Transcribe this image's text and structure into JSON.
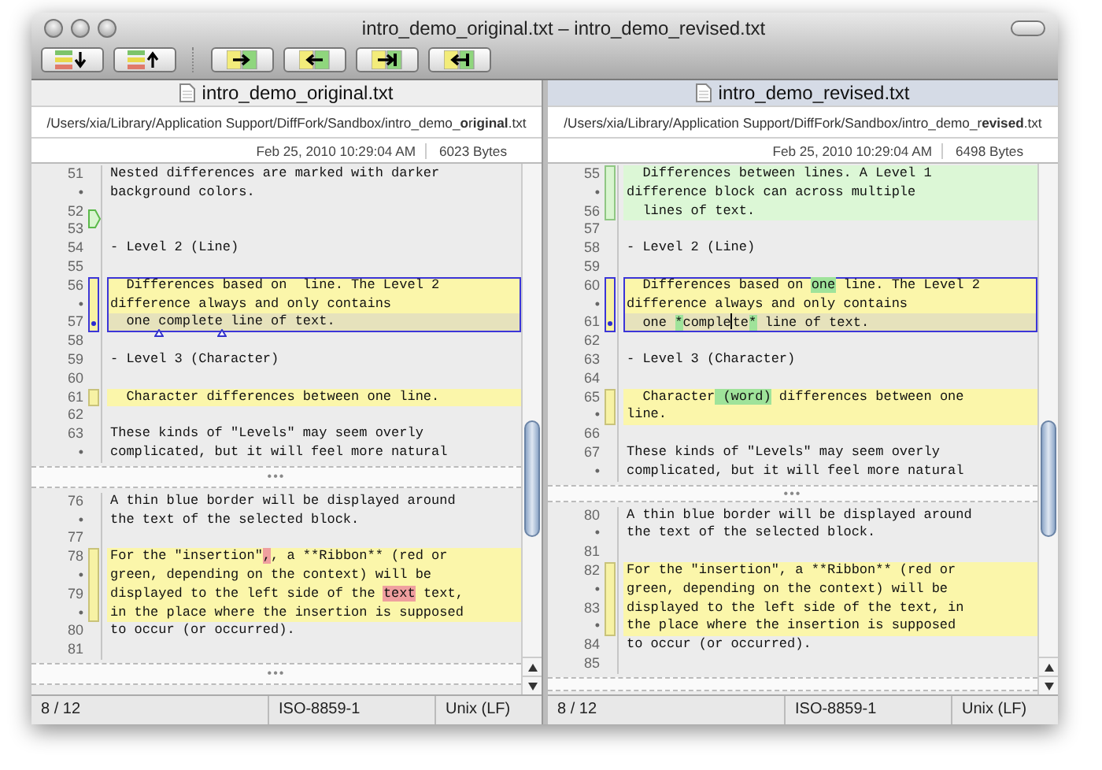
{
  "window": {
    "title": "intro_demo_original.txt – intro_demo_revised.txt"
  },
  "panes": [
    {
      "filename": "intro_demo_original.txt",
      "selected": false,
      "path": "/Users/xia/Library/Application Support/DiffFork/Sandbox/intro_demo_**o**r**iginal**.txt",
      "date": "Feb 25, 2010 10:29:04 AM",
      "size": "6023 Bytes",
      "sections": [
        {
          "fold_label": "•••",
          "blocks": [
            {
              "kind": "plain",
              "selected": false,
              "lines": [
                {
                  "num": "51",
                  "current": false,
                  "text": "Nested differences are marked with darker"
                },
                {
                  "num": "•",
                  "current": false,
                  "text": "background colors."
                }
              ]
            },
            {
              "kind": "insertion",
              "selected": false,
              "lines": [
                {
                  "num": "52",
                  "current": false
                }
              ]
            },
            {
              "kind": "plain",
              "selected": false,
              "lines": [
                {
                  "num": "53",
                  "current": false
                },
                {
                  "num": "54",
                  "current": false,
                  "text": "- Level 2 (Line)"
                },
                {
                  "num": "55",
                  "current": false
                }
              ]
            },
            {
              "kind": "changed",
              "selected": true,
              "lines": [
                {
                  "num": "56",
                  "current": false,
                  "text": "  Differences based on  line. The Level 2"
                },
                {
                  "num": "•",
                  "current": false,
                  "text": "difference always and only contains"
                },
                {
                  "num": "57",
                  "current": true,
                  "parts": [
                    {
                      "text": "  one ",
                      "kind": "plain"
                    },
                    {
                      "text": "complete",
                      "kind": "plain",
                      "insert_marks": true
                    },
                    {
                      "text": " line of text.",
                      "kind": "plain"
                    }
                  ]
                }
              ]
            },
            {
              "kind": "plain",
              "selected": false,
              "lines": [
                {
                  "num": "58",
                  "current": false
                },
                {
                  "num": "59",
                  "current": false,
                  "text": "- Level 3 (Character)"
                },
                {
                  "num": "60",
                  "current": false
                }
              ]
            },
            {
              "kind": "changed",
              "selected": false,
              "lines": [
                {
                  "num": "61",
                  "current": false,
                  "text": "  Character differences between one line."
                }
              ]
            },
            {
              "kind": "plain",
              "selected": false,
              "lines": [
                {
                  "num": "62",
                  "current": false
                },
                {
                  "num": "63",
                  "current": false,
                  "text": "These kinds of \"Levels\" may seem overly"
                },
                {
                  "num": "•",
                  "current": false,
                  "text": "complicated, but it will feel more natural"
                }
              ]
            }
          ]
        },
        {
          "fold_label": "•••",
          "blocks": [
            {
              "kind": "plain",
              "selected": false,
              "lines": [
                {
                  "num": "76",
                  "current": false,
                  "text": "A thin blue border will be displayed around"
                },
                {
                  "num": "•",
                  "current": false,
                  "text": "the text of the selected block."
                },
                {
                  "num": "77",
                  "current": false
                }
              ]
            },
            {
              "kind": "changed",
              "selected": false,
              "lines": [
                {
                  "num": "78",
                  "current": false,
                  "parts": [
                    {
                      "text": "For the \"insertion\"",
                      "kind": "plain"
                    },
                    {
                      "text": ",",
                      "kind": "removed"
                    },
                    {
                      "text": ", a **Ribbon** (red or",
                      "kind": "plain"
                    }
                  ]
                },
                {
                  "num": "•",
                  "current": false,
                  "text": "green, depending on the context) will be"
                },
                {
                  "num": "79",
                  "current": false,
                  "parts": [
                    {
                      "text": "displayed to the left side of the ",
                      "kind": "plain"
                    },
                    {
                      "text": "text",
                      "kind": "removed"
                    },
                    {
                      "text": " text,",
                      "kind": "plain"
                    }
                  ]
                },
                {
                  "num": "•",
                  "current": false,
                  "text": "in the place where the insertion is supposed"
                }
              ]
            },
            {
              "kind": "plain",
              "selected": false,
              "lines": [
                {
                  "num": "80",
                  "current": false,
                  "text": "to occur (or occurred)."
                },
                {
                  "num": "81",
                  "current": false
                }
              ]
            }
          ]
        }
      ],
      "status": [
        "8 / 12",
        "ISO-8859-1",
        "Unix (LF)"
      ]
    },
    {
      "filename": "intro_demo_revised.txt",
      "selected": true,
      "path": "/Users/xia/Library/Application Support/DiffFork/Sandbox/intro_demo_r**evised**.txt",
      "date": "Feb 25, 2010 10:29:04 AM",
      "size": "6498 Bytes",
      "sections": [
        {
          "fold_label": "•••",
          "blocks": [
            {
              "kind": "added",
              "selected": false,
              "lines": [
                {
                  "num": "55",
                  "current": false,
                  "text": "  Differences between lines. A Level 1"
                },
                {
                  "num": "•",
                  "current": false,
                  "text": "difference block can across multiple"
                },
                {
                  "num": "56",
                  "current": false,
                  "text": "  lines of text."
                }
              ]
            },
            {
              "kind": "plain",
              "selected": false,
              "lines": [
                {
                  "num": "57",
                  "current": false
                },
                {
                  "num": "58",
                  "current": false,
                  "text": "- Level 2 (Line)"
                },
                {
                  "num": "59",
                  "current": false
                }
              ]
            },
            {
              "kind": "changed",
              "selected": true,
              "lines": [
                {
                  "num": "60",
                  "current": false,
                  "parts": [
                    {
                      "text": "  Differences based on ",
                      "kind": "plain"
                    },
                    {
                      "text": "one",
                      "kind": "added"
                    },
                    {
                      "text": " line. The Level 2",
                      "kind": "plain"
                    }
                  ]
                },
                {
                  "num": "•",
                  "current": false,
                  "text": "difference always and only contains"
                },
                {
                  "num": "61",
                  "current": true,
                  "parts": [
                    {
                      "text": "  one ",
                      "kind": "plain"
                    },
                    {
                      "text": "*",
                      "kind": "added"
                    },
                    {
                      "text": "comple",
                      "kind": "plain",
                      "cursor_after": true
                    },
                    {
                      "text": "te",
                      "kind": "plain"
                    },
                    {
                      "text": "*",
                      "kind": "added"
                    },
                    {
                      "text": " line of text.",
                      "kind": "plain"
                    }
                  ]
                }
              ]
            },
            {
              "kind": "plain",
              "selected": false,
              "lines": [
                {
                  "num": "62",
                  "current": false
                },
                {
                  "num": "63",
                  "current": false,
                  "text": "- Level 3 (Character)"
                },
                {
                  "num": "64",
                  "current": false
                }
              ]
            },
            {
              "kind": "changed",
              "selected": false,
              "lines": [
                {
                  "num": "65",
                  "current": false,
                  "parts": [
                    {
                      "text": "  Character",
                      "kind": "plain"
                    },
                    {
                      "text": " (word)",
                      "kind": "added"
                    },
                    {
                      "text": " differences between one",
                      "kind": "plain"
                    }
                  ]
                },
                {
                  "num": "•",
                  "current": false,
                  "text": "line."
                }
              ]
            },
            {
              "kind": "plain",
              "selected": false,
              "lines": [
                {
                  "num": "66",
                  "current": false
                },
                {
                  "num": "67",
                  "current": false,
                  "text": "These kinds of \"Levels\" may seem overly"
                },
                {
                  "num": "•",
                  "current": false,
                  "text": "complicated, but it will feel more natural"
                }
              ]
            }
          ]
        },
        {
          "blocks": [
            {
              "kind": "plain",
              "selected": false,
              "lines": [
                {
                  "num": "80",
                  "current": false,
                  "text": "A thin blue border will be displayed around"
                },
                {
                  "num": "•",
                  "current": false,
                  "text": "the text of the selected block."
                },
                {
                  "num": "81",
                  "current": false
                }
              ]
            },
            {
              "kind": "changed",
              "selected": false,
              "lines": [
                {
                  "num": "82",
                  "current": false,
                  "text": "For the \"insertion\", a **Ribbon** (red or"
                },
                {
                  "num": "•",
                  "current": false,
                  "text": "green, depending on the context) will be"
                },
                {
                  "num": "83",
                  "current": false,
                  "text": "displayed to the left side of the text, in"
                },
                {
                  "num": "•",
                  "current": false,
                  "text": "the place where the insertion is supposed"
                }
              ]
            },
            {
              "kind": "plain",
              "selected": false,
              "lines": [
                {
                  "num": "84",
                  "current": false,
                  "text": "to occur (or occurred)."
                },
                {
                  "num": "85",
                  "current": false
                }
              ]
            }
          ]
        }
      ],
      "status": [
        "8 / 12",
        "ISO-8859-1",
        "Unix (LF)"
      ]
    }
  ]
}
